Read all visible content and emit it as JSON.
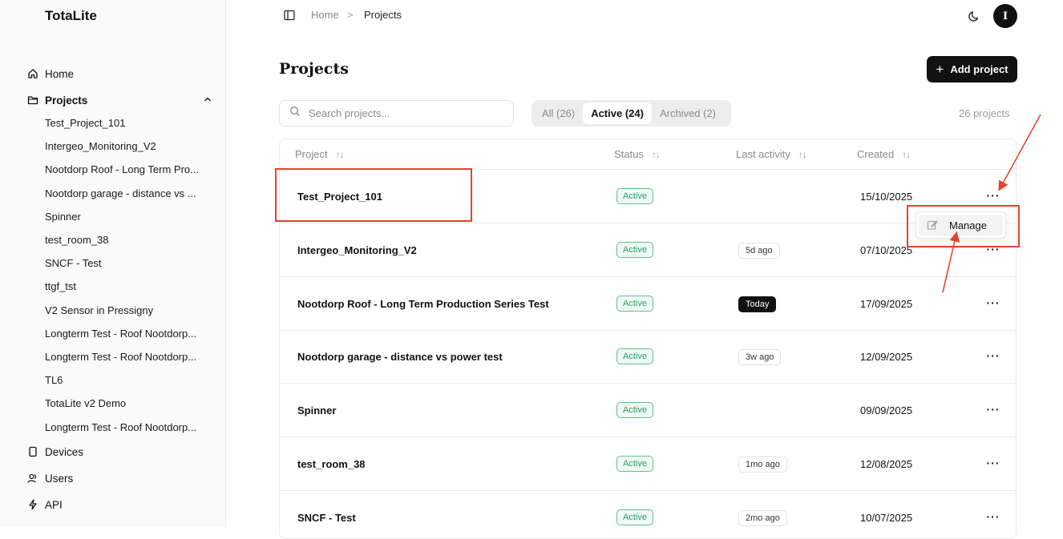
{
  "app": {
    "brand": "TotaLite"
  },
  "sidebar": {
    "nav": [
      {
        "label": "Home",
        "icon": "home-icon"
      },
      {
        "label": "Projects",
        "icon": "folder-icon"
      },
      {
        "label": "Devices",
        "icon": "device-icon"
      },
      {
        "label": "Users",
        "icon": "users-icon"
      },
      {
        "label": "API",
        "icon": "api-icon"
      }
    ],
    "projects": [
      "Test_Project_101",
      "Intergeo_Monitoring_V2",
      "Nootdorp Roof - Long Term Pro...",
      "Nootdorp garage - distance vs ...",
      "Spinner",
      "test_room_38",
      "SNCF - Test",
      "ttgf_tst",
      "V2 Sensor in Pressigny",
      "Longterm Test - Roof Nootdorp...",
      "Longterm Test - Roof Nootdorp...",
      "TL6",
      "TotaLite v2 Demo",
      "Longterm Test - Roof Nootdorp..."
    ]
  },
  "breadcrumb": {
    "home": "Home",
    "sep": ">",
    "current": "Projects"
  },
  "user": {
    "initial": "I"
  },
  "page": {
    "title": "Projects",
    "add_button": "Add project",
    "search_placeholder": "Search projects...",
    "tabs": [
      "All (26)",
      "Active (24)",
      "Archived (2)"
    ],
    "active_tab": "Active (24)",
    "count": "26 projects"
  },
  "table": {
    "headers": [
      "Project",
      "Status",
      "Last activity",
      "Created"
    ],
    "rows": [
      {
        "name": "Test_Project_101",
        "status": "Active",
        "activity": "",
        "created": "15/10/2025"
      },
      {
        "name": "Intergeo_Monitoring_V2",
        "status": "Active",
        "activity": "5d ago",
        "created": "07/10/2025"
      },
      {
        "name": "Nootdorp Roof - Long Term Production Series Test",
        "status": "Active",
        "activity": "Today",
        "created": "17/09/2025"
      },
      {
        "name": "Nootdorp garage - distance vs power test",
        "status": "Active",
        "activity": "3w ago",
        "created": "12/09/2025"
      },
      {
        "name": "Spinner",
        "status": "Active",
        "activity": "",
        "created": "09/09/2025"
      },
      {
        "name": "test_room_38",
        "status": "Active",
        "activity": "1mo ago",
        "created": "12/08/2025"
      },
      {
        "name": "SNCF - Test",
        "status": "Active",
        "activity": "2mo ago",
        "created": "10/07/2025"
      }
    ]
  },
  "menu": {
    "item": "Manage"
  },
  "colors": {
    "accent": "#111111",
    "annotation": "#e0462c",
    "active_green": "#2e9c62"
  }
}
